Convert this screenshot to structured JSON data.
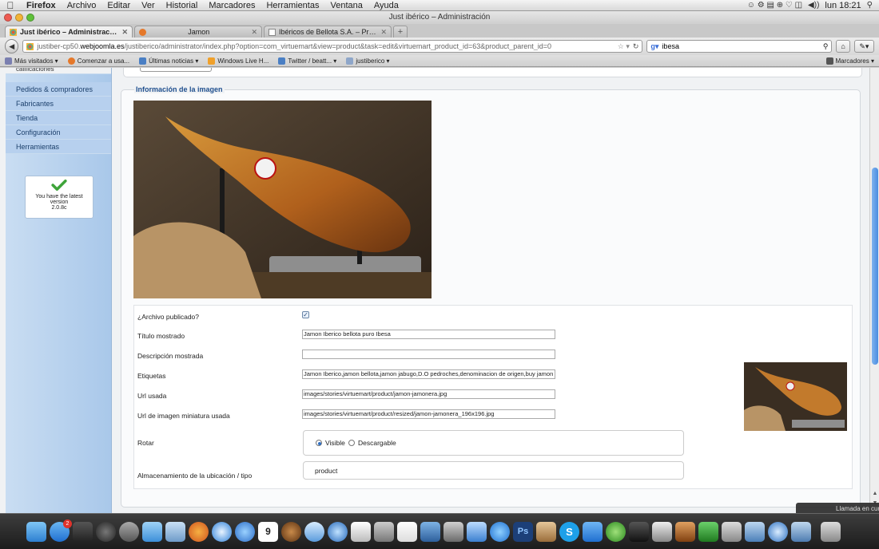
{
  "menubar": {
    "app": "Firefox",
    "items": [
      "Archivo",
      "Editar",
      "Ver",
      "Historial",
      "Marcadores",
      "Herramientas",
      "Ventana",
      "Ayuda"
    ],
    "clock": "lun 18:21"
  },
  "window": {
    "title": "Just ibérico – Administración"
  },
  "tabs": [
    {
      "label": "Just ibérico – Administración",
      "active": true
    },
    {
      "label": "Jamon",
      "active": false
    },
    {
      "label": "Ibéricos de Bellota S.A. – Produc...",
      "active": false
    }
  ],
  "nav": {
    "url_prefix": "justiber-cp50.",
    "url_host": "webjoomla.es",
    "url_rest": "/justiberico/administrator/index.php?option=com_virtuemart&view=product&task=edit&virtuemart_product_id=63&product_parent_id=0",
    "search_value": "ibesa"
  },
  "bookmarks": {
    "items": [
      "Más visitados ▾",
      "Comenzar a usa...",
      "Últimas noticias ▾",
      "Windows Live H...",
      "Twitter / beatt... ▾",
      "justiberico ▾"
    ],
    "right": "Marcadores ▾"
  },
  "sidebar": {
    "cut_item": "calificaciones",
    "items": [
      "Pedidos & compradores",
      "Fabricantes",
      "Tienda",
      "Configuración",
      "Herramientas"
    ],
    "version": {
      "line1": "You have the latest",
      "line2": "version",
      "number": "2.0.8c"
    }
  },
  "image_info": {
    "legend": "Información de la imagen",
    "published_label": "¿Archivo publicado?",
    "published_checked": "✓",
    "title_label": "Título mostrado",
    "title_value": "Jamon Iberico bellota puro Ibesa",
    "desc_label": "Descripción mostrada",
    "desc_value": "",
    "tags_label": "Etiquetas",
    "tags_value": "Jamon Iberico,jamon bellota,jamon jabugo,D.O pedroches,denominacion de origen,buy jamon",
    "url_label": "Url usada",
    "url_value": "images/stories/virtuemart/product/jamon-jamonera.jpg",
    "thumb_url_label": "Url de imagen miniatura usada",
    "thumb_url_value": "images/stories/virtuemart/product/resized/jamon-jamonera_196x196.jpg",
    "rotate_label": "Rotar",
    "radio_visible": "Visible",
    "radio_download": "Descargable",
    "storage_label": "Almacenamiento de la ubicación / tipo",
    "storage_value": "product"
  },
  "dock": {
    "icons": [
      "finder-icon",
      "app-store-icon",
      "imovie-icon",
      "dashboard-icon",
      "launchpad-icon",
      "facetime-icon",
      "preview-icon",
      "firefox-icon",
      "safari-icon",
      "itunes-icon",
      "calendar-icon",
      "mail-icon",
      "skype-icon",
      "photoshop-icon",
      "dropbox-icon",
      "terminal-icon",
      "trash-icon"
    ],
    "mail_badge": "2",
    "calendar_day": "9",
    "notification": "Llamada en cur"
  },
  "colors": {
    "accent": "#1f4f8e",
    "sidebar": "#b7d0ee",
    "scroll": "#4a8ce0"
  }
}
